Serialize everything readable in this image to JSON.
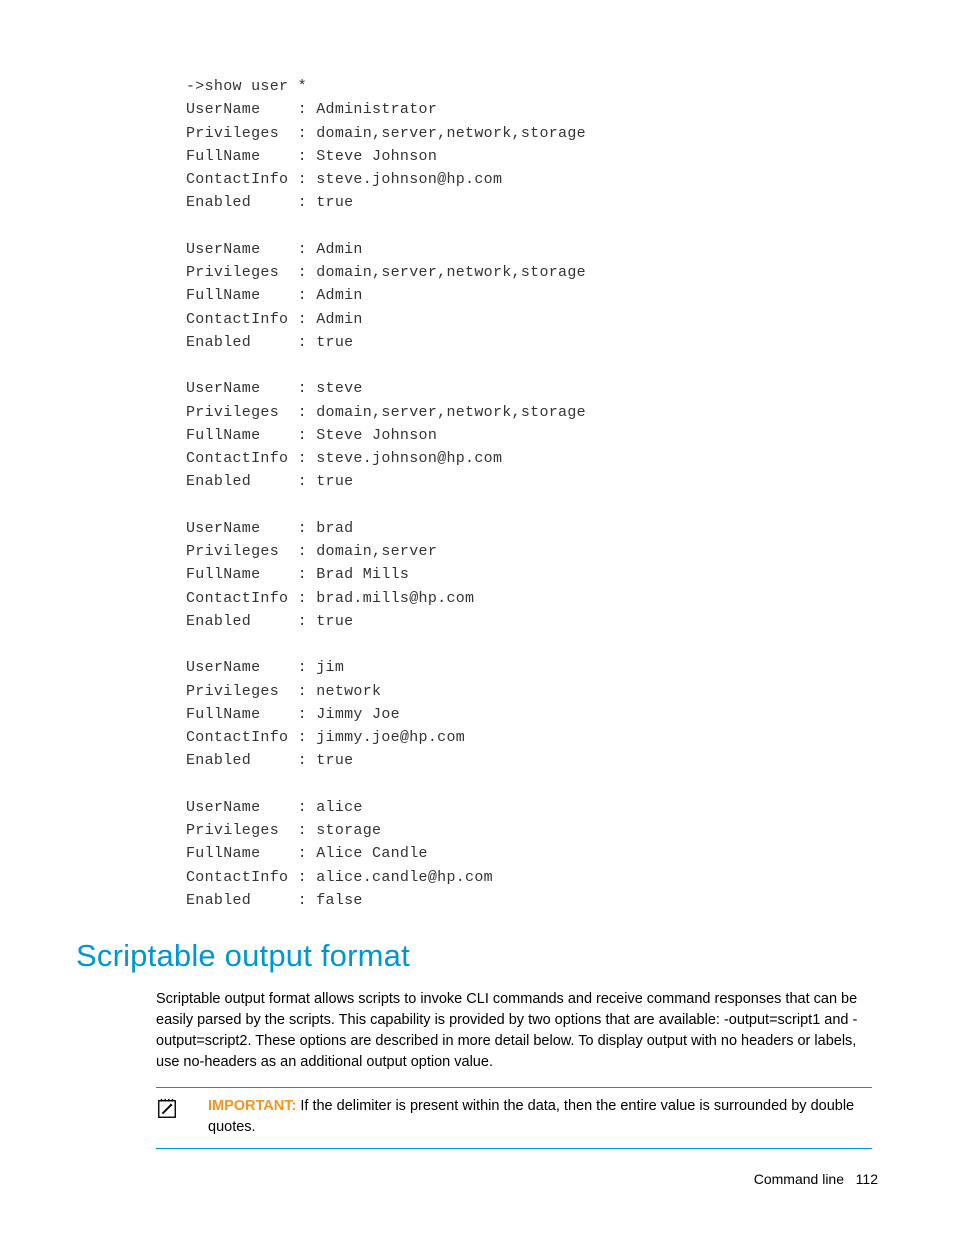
{
  "cli_output": "->show user *\nUserName    : Administrator\nPrivileges  : domain,server,network,storage\nFullName    : Steve Johnson\nContactInfo : steve.johnson@hp.com\nEnabled     : true\n\nUserName    : Admin\nPrivileges  : domain,server,network,storage\nFullName    : Admin\nContactInfo : Admin\nEnabled     : true\n\nUserName    : steve\nPrivileges  : domain,server,network,storage\nFullName    : Steve Johnson\nContactInfo : steve.johnson@hp.com\nEnabled     : true\n\nUserName    : brad\nPrivileges  : domain,server\nFullName    : Brad Mills\nContactInfo : brad.mills@hp.com\nEnabled     : true\n\nUserName    : jim\nPrivileges  : network\nFullName    : Jimmy Joe\nContactInfo : jimmy.joe@hp.com\nEnabled     : true\n\nUserName    : alice\nPrivileges  : storage\nFullName    : Alice Candle\nContactInfo : alice.candle@hp.com\nEnabled     : false",
  "heading": "Scriptable output format",
  "paragraph": "Scriptable output format allows scripts to invoke CLI commands and receive command responses that can be easily parsed by the scripts. This capability is provided by two options that are available: -output=script1 and -output=script2. These options are described in more detail below. To display output with no headers or labels, use no-headers as an additional output option value.",
  "callout": {
    "label": "IMPORTANT:",
    "text": "  If the delimiter is present within the data, then the entire value is surrounded by double quotes."
  },
  "footer": {
    "section": "Command line",
    "page": "112"
  }
}
